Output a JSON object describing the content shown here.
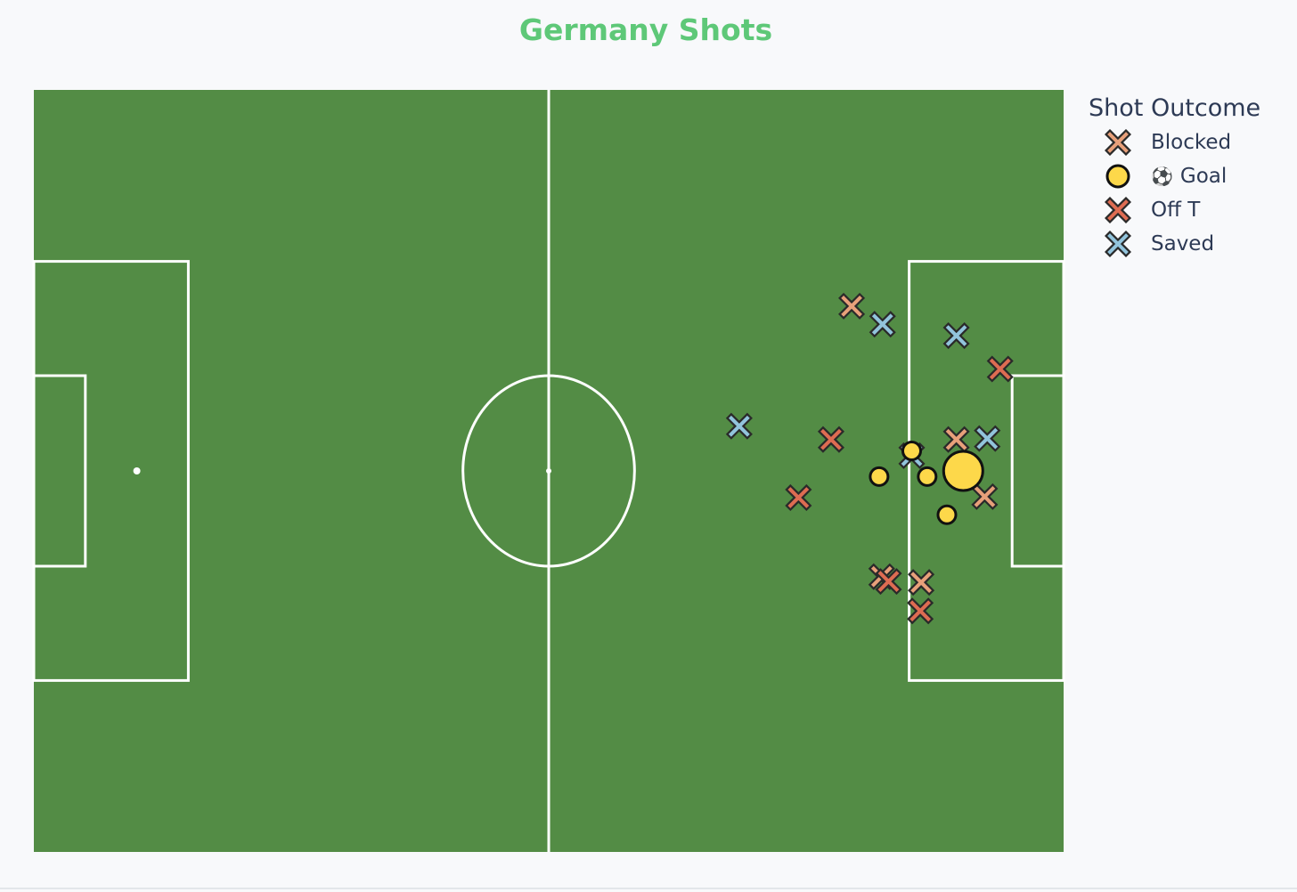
{
  "chart_data": {
    "type": "scatter",
    "title": "Germany Shots",
    "pitch": {
      "x_range": [
        0,
        120
      ],
      "y_range": [
        0,
        80
      ],
      "color": "#538c45",
      "line_color": "#ffffff"
    },
    "legend": {
      "title": "Shot Outcome",
      "placement": "right",
      "entries": [
        {
          "name": "Blocked",
          "symbol": "x",
          "color": "#e8a07a",
          "prefix": ""
        },
        {
          "name": "Goal",
          "symbol": "circle",
          "color": "#fdd84a",
          "prefix": "⚽"
        },
        {
          "name": "Off T",
          "symbol": "x",
          "color": "#de6c52",
          "prefix": ""
        },
        {
          "name": "Saved",
          "symbol": "x",
          "color": "#92c4dc",
          "prefix": ""
        }
      ]
    },
    "series": [
      {
        "name": "Blocked",
        "symbol": "x",
        "color": "#e8a07a",
        "points": [
          [
            95.3,
            57.3
          ],
          [
            107.5,
            43.3
          ],
          [
            110.8,
            37.3
          ],
          [
            98.8,
            28.9
          ],
          [
            103.4,
            28.3
          ]
        ]
      },
      {
        "name": "Off T",
        "symbol": "x",
        "color": "#de6c52",
        "points": [
          [
            92.9,
            43.3
          ],
          [
            89.1,
            37.2
          ],
          [
            112.6,
            50.7
          ],
          [
            99.6,
            28.4
          ],
          [
            103.3,
            25.3
          ]
        ]
      },
      {
        "name": "Saved",
        "symbol": "x",
        "color": "#92c4dc",
        "points": [
          [
            98.9,
            55.4
          ],
          [
            107.5,
            54.2
          ],
          [
            82.2,
            44.7
          ],
          [
            111.1,
            43.4
          ],
          [
            102.3,
            41.6
          ]
        ]
      },
      {
        "name": "Goal",
        "symbol": "circle",
        "color": "#fdd84a",
        "points": [
          [
            102.3,
            42.1,
            1
          ],
          [
            98.5,
            39.4,
            1
          ],
          [
            104.1,
            39.4,
            1
          ],
          [
            108.3,
            40.0,
            2.2
          ],
          [
            106.4,
            35.4,
            1
          ]
        ]
      }
    ]
  }
}
